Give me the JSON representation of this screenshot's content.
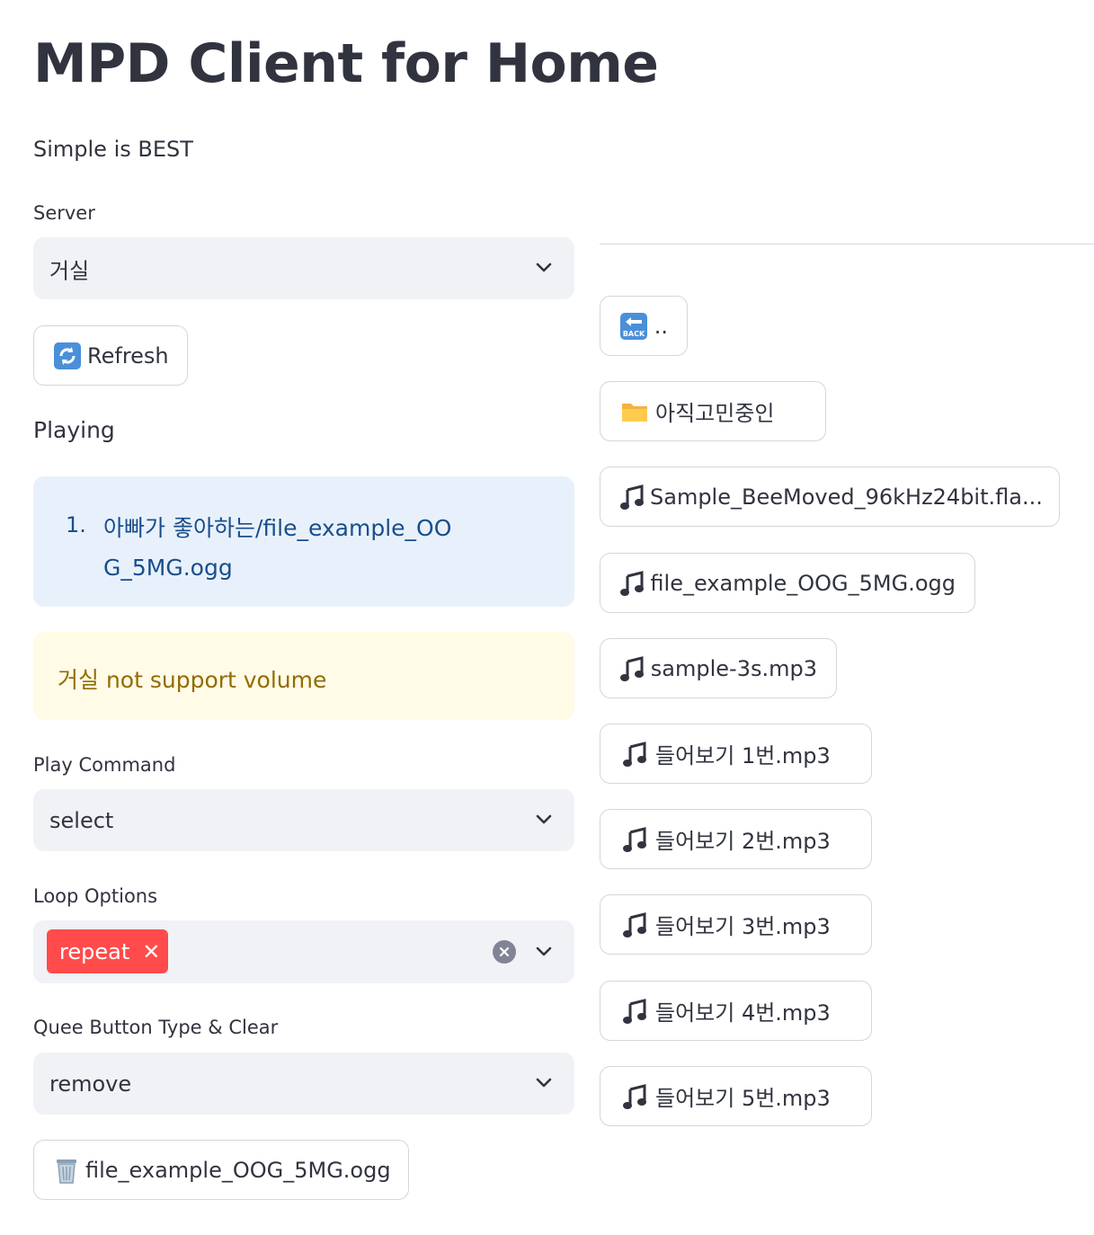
{
  "header": {
    "title": "MPD Client for Home",
    "subtitle": "Simple is BEST"
  },
  "server": {
    "label": "Server",
    "selected": "거실"
  },
  "refresh_button": {
    "icon": "arrows-counterclockwise-icon",
    "label": "Refresh"
  },
  "playing": {
    "label": "Playing",
    "items": [
      {
        "number": "1.",
        "text": "아빠가 좋아하는/file_example_OOG_5MG.ogg"
      }
    ]
  },
  "volume_warning": {
    "text": "거실 not support volume"
  },
  "play_command": {
    "label": "Play Command",
    "selected": "select"
  },
  "loop_options": {
    "label": "Loop Options",
    "selected_tags": [
      "repeat"
    ],
    "tag_color": "#ff4b4b"
  },
  "queue_button_type": {
    "label": "Quee Button Type & Clear",
    "selected": "remove"
  },
  "queue_items": [
    {
      "icon": "wastebasket-icon",
      "label": "file_example_OOG_5MG.ogg"
    }
  ],
  "browser": {
    "back_button": {
      "icon": "back-arrow-icon",
      "label": ".."
    },
    "folders": [
      {
        "icon": "folder-icon",
        "label": "아직고민중인"
      }
    ],
    "files": [
      {
        "icon": "music-note-icon",
        "label": "Sample_BeeMoved_96kHz24bit.fla..."
      },
      {
        "icon": "music-note-icon",
        "label": "file_example_OOG_5MG.ogg"
      },
      {
        "icon": "music-note-icon",
        "label": "sample-3s.mp3"
      },
      {
        "icon": "music-note-icon",
        "label": "들어보기 1번.mp3"
      },
      {
        "icon": "music-note-icon",
        "label": "들어보기 2번.mp3"
      },
      {
        "icon": "music-note-icon",
        "label": "들어보기 3번.mp3"
      },
      {
        "icon": "music-note-icon",
        "label": "들어보기 4번.mp3"
      },
      {
        "icon": "music-note-icon",
        "label": "들어보기 5번.mp3"
      }
    ]
  },
  "colors": {
    "text": "#31333f",
    "select_bg": "#f0f2f6",
    "info_bg": "#e8f1fb",
    "info_text": "#194e8c",
    "warning_bg": "#fffbe6",
    "warning_text": "#926c05",
    "accent": "#ff4b4b"
  }
}
